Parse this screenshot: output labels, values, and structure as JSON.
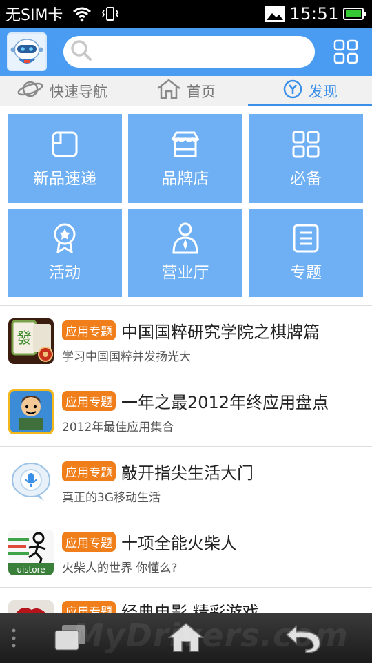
{
  "status_bar": {
    "carrier": "无SIM卡",
    "time": "15:51"
  },
  "header": {
    "avatar_icon": "robot-avatar-icon",
    "search_placeholder": "",
    "grid_icon": "grid-icon"
  },
  "tabs": [
    {
      "label": "快速导航",
      "icon": "planet-icon",
      "active": false
    },
    {
      "label": "首页",
      "icon": "home-icon",
      "active": false
    },
    {
      "label": "发现",
      "icon": "discover-icon",
      "active": true
    }
  ],
  "tiles": [
    {
      "label": "新品速递",
      "icon": "new-product-icon"
    },
    {
      "label": "品牌店",
      "icon": "store-icon"
    },
    {
      "label": "必备",
      "icon": "essentials-icon"
    },
    {
      "label": "活动",
      "icon": "award-icon"
    },
    {
      "label": "营业厅",
      "icon": "service-hall-icon"
    },
    {
      "label": "专题",
      "icon": "topic-icon"
    }
  ],
  "list": [
    {
      "badge": "应用专题",
      "title": "中国国粹研究学院之棋牌篇",
      "subtitle": "学习中国国粹并发扬光大",
      "thumb": "mahjong-icon"
    },
    {
      "badge": "应用专题",
      "title": "一年之最2012年终应用盘点",
      "subtitle": "2012年最佳应用集合",
      "thumb": "jetpack-icon"
    },
    {
      "badge": "应用专题",
      "title": "敲开指尖生活大门",
      "subtitle": "真正的3G移动生活",
      "thumb": "voice-icon"
    },
    {
      "badge": "应用专题",
      "title": "十项全能火柴人",
      "subtitle": "火柴人的世界 你懂么?",
      "thumb": "stickman-icon"
    },
    {
      "badge": "应用专题",
      "title": "经典电影 精彩游戏",
      "subtitle": "",
      "thumb": "movie-game-icon"
    }
  ],
  "thumb_labels": {
    "stickman": "uistore"
  },
  "bottom_nav": {
    "watermark": "MyDrivers.com"
  },
  "colors": {
    "primary": "#4a9cf2",
    "tile": "#6fb0f5",
    "badge": "#f07f1b",
    "active_tab": "#3a8fe8"
  }
}
